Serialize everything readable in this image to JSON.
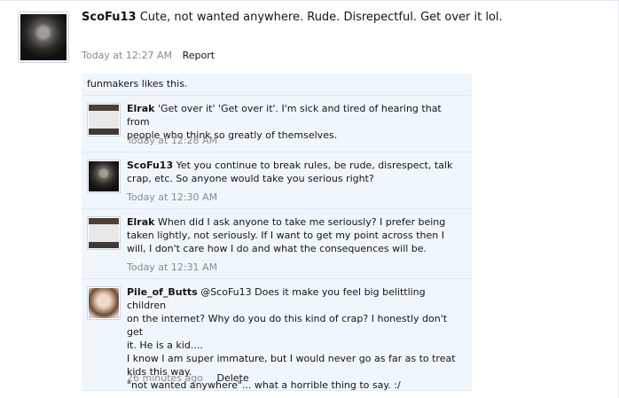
{
  "status": {
    "username": "ScoFu13",
    "message": "Cute, not wanted anywhere. Rude. Disrepectful. Get over it lol.",
    "timestamp": "Today at 12:27 AM",
    "report_label": "Report"
  },
  "likes": {
    "text": "funmakers likes this."
  },
  "comments": [
    {
      "username": "Elrak",
      "lines": [
        "'Get over it' 'Get over it'. I'm sick and tired of hearing that from",
        "people who think so greatly of themselves."
      ],
      "timestamp": "Today at 12:28 AM"
    },
    {
      "username": "ScoFu13",
      "lines": [
        "Yet you continue to break rules, be rude, disrespect, talk",
        "crap, etc. So anyone would take you serious right?"
      ],
      "timestamp": "Today at 12:30 AM"
    },
    {
      "username": "Elrak",
      "lines": [
        "When did I ask anyone to take me seriously? I prefer being",
        "taken lightly, not seriously. If I want to get my point across then I",
        "will, I don't care how I do and what the consequences will be."
      ],
      "timestamp": "Today at 12:31 AM"
    },
    {
      "username": "Pile_of_Butts",
      "lines": [
        "@ScoFu13 Does it make you feel big belittling children",
        "on the internet? Why do you do this kind of crap? I honestly don't get",
        "it. He is a kid....",
        "I know I am super immature, but I would never go as far as to treat",
        "kids this way.",
        "\"not wanted anywhere\"... what a horrible thing to say. :/"
      ],
      "timestamp": "26 minutes ago",
      "delete_label": "Delete"
    }
  ]
}
